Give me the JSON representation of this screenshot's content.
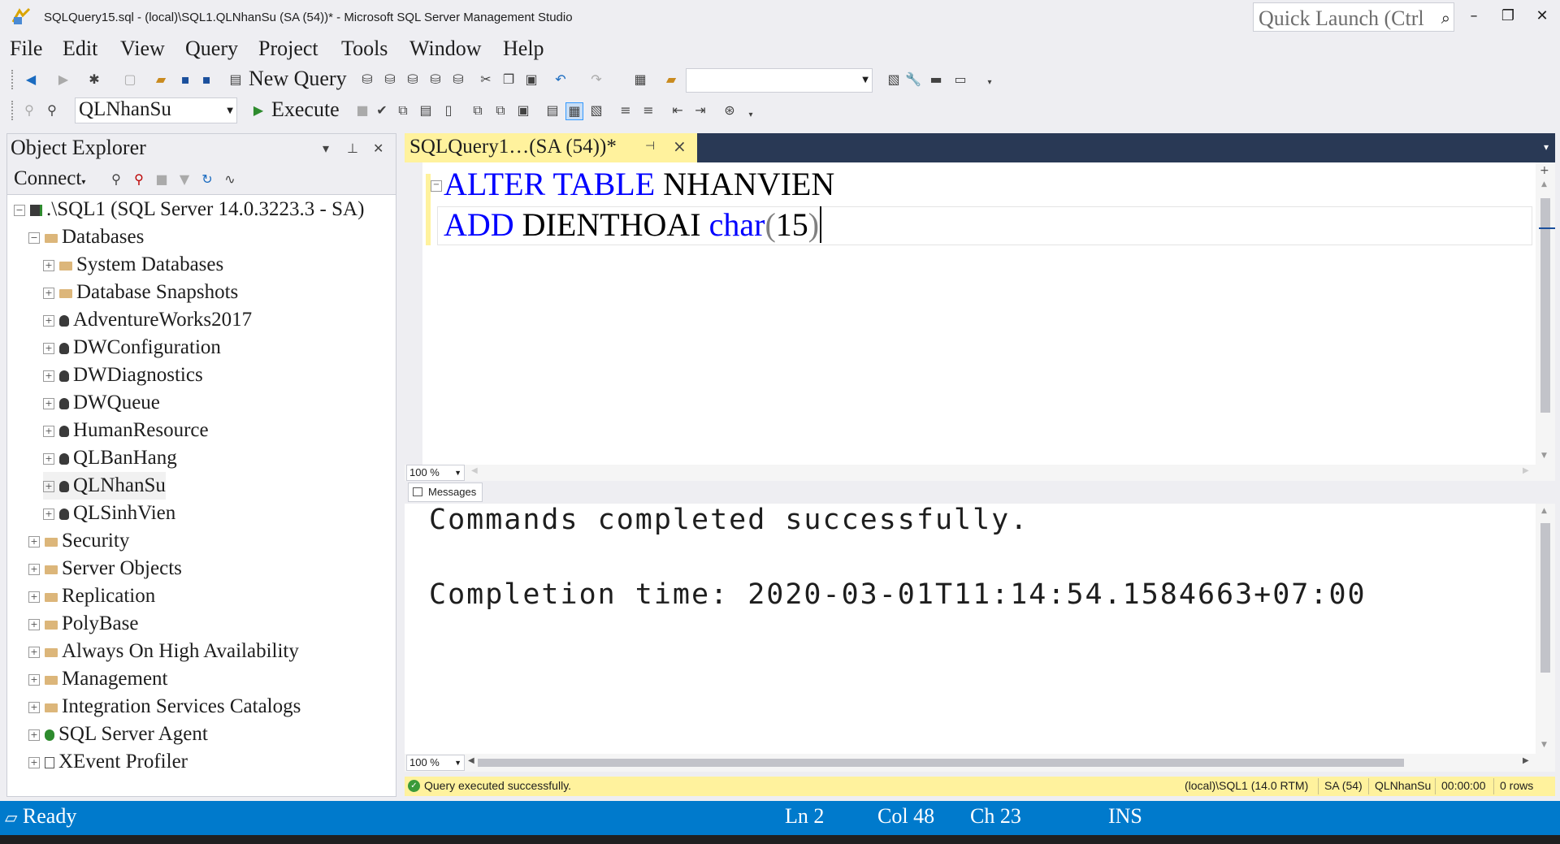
{
  "window": {
    "title": "SQLQuery15.sql - (local)\\SQL1.QLNhanSu (SA (54))* - Microsoft SQL Server Management Studio",
    "quick_launch_placeholder": "Quick Launch (Ctrl"
  },
  "menu": [
    "File",
    "Edit",
    "View",
    "Query",
    "Project",
    "Tools",
    "Window",
    "Help"
  ],
  "toolbar": {
    "new_query_label": "New Query",
    "database_combo": "QLNhanSu",
    "execute_label": "Execute"
  },
  "object_explorer": {
    "title": "Object Explorer",
    "connect_label": "Connect",
    "tree": [
      {
        "label": ".\\SQL1 (SQL Server 14.0.3223.3 - SA)",
        "level": 0,
        "expander": "⊟",
        "icon": "server-icon"
      },
      {
        "label": "Databases",
        "level": 1,
        "expander": "⊟",
        "icon": "folder-icon"
      },
      {
        "label": "System Databases",
        "level": 2,
        "expander": "⊞",
        "icon": "folder-icon"
      },
      {
        "label": "Database Snapshots",
        "level": 2,
        "expander": "⊞",
        "icon": "folder-icon"
      },
      {
        "label": "AdventureWorks2017",
        "level": 2,
        "expander": "⊞",
        "icon": "database-icon"
      },
      {
        "label": "DWConfiguration",
        "level": 2,
        "expander": "⊞",
        "icon": "database-icon"
      },
      {
        "label": "DWDiagnostics",
        "level": 2,
        "expander": "⊞",
        "icon": "database-icon"
      },
      {
        "label": "DWQueue",
        "level": 2,
        "expander": "⊞",
        "icon": "database-icon"
      },
      {
        "label": "HumanResource",
        "level": 2,
        "expander": "⊞",
        "icon": "database-icon"
      },
      {
        "label": "QLBanHang",
        "level": 2,
        "expander": "⊞",
        "icon": "database-icon"
      },
      {
        "label": "QLNhanSu",
        "level": 2,
        "expander": "⊞",
        "icon": "database-icon",
        "selected": true
      },
      {
        "label": "QLSinhVien",
        "level": 2,
        "expander": "⊞",
        "icon": "database-icon"
      },
      {
        "label": "Security",
        "level": 1,
        "expander": "⊞",
        "icon": "folder-icon"
      },
      {
        "label": "Server Objects",
        "level": 1,
        "expander": "⊞",
        "icon": "folder-icon"
      },
      {
        "label": "Replication",
        "level": 1,
        "expander": "⊞",
        "icon": "folder-icon"
      },
      {
        "label": "PolyBase",
        "level": 1,
        "expander": "⊞",
        "icon": "folder-icon"
      },
      {
        "label": "Always On High Availability",
        "level": 1,
        "expander": "⊞",
        "icon": "folder-icon"
      },
      {
        "label": "Management",
        "level": 1,
        "expander": "⊞",
        "icon": "folder-icon"
      },
      {
        "label": "Integration Services Catalogs",
        "level": 1,
        "expander": "⊞",
        "icon": "folder-icon"
      },
      {
        "label": "SQL Server Agent",
        "level": 1,
        "expander": "⊞",
        "icon": "agent-icon"
      },
      {
        "label": "XEvent Profiler",
        "level": 1,
        "expander": "⊞",
        "icon": "profiler-icon"
      }
    ]
  },
  "editor": {
    "tab_label": "SQLQuery1…(SA (54))*",
    "line1": {
      "kw": "ALTER TABLE",
      "id": " NHANVIEN"
    },
    "line2": {
      "kw": "ADD",
      "id": " DIENTHOAI ",
      "type": "char",
      "open": "(",
      "num": "15",
      "close": ")"
    },
    "zoom": "100 %"
  },
  "messages": {
    "tab_label": "Messages",
    "line1": "Commands completed successfully.",
    "line2": "Completion time: 2020-03-01T11:14:54.1584663+07:00",
    "zoom": "100 %"
  },
  "query_status": {
    "message": "Query executed successfully.",
    "server": "(local)\\SQL1 (14.0 RTM)",
    "user": "SA (54)",
    "database": "QLNhanSu",
    "elapsed": "00:00:00",
    "rows": "0 rows"
  },
  "statusbar": {
    "ready": "Ready",
    "ln": "Ln 2",
    "col": "Col 48",
    "ch": "Ch 23",
    "ins": "INS"
  },
  "colors": {
    "accent": "#007acc",
    "tab_active": "#fff29d",
    "keyword": "#0000ff"
  }
}
